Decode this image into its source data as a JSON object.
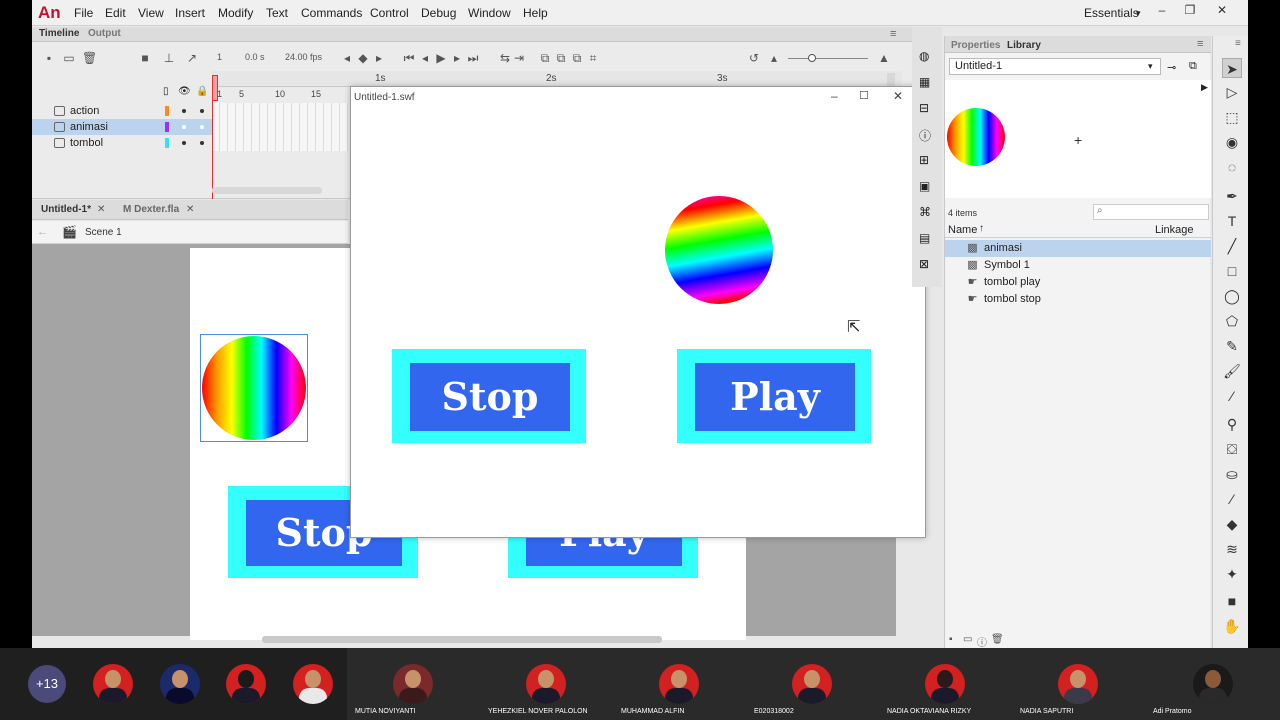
{
  "app": {
    "logo": "An",
    "menu": [
      "File",
      "Edit",
      "View",
      "Insert",
      "Modify",
      "Text",
      "Commands",
      "Control",
      "Debug",
      "Window",
      "Help"
    ],
    "workspace": "Essentials"
  },
  "timeline": {
    "tabs": [
      "Timeline",
      "Output"
    ],
    "frame": "1",
    "time": "0.0 s",
    "fps": "24.00 fps",
    "ruler_seconds": [
      "1s",
      "2s",
      "3s"
    ],
    "ruler_frames": [
      "1",
      "5",
      "10",
      "15"
    ],
    "layers": [
      {
        "name": "action",
        "color": "#ff8c1a"
      },
      {
        "name": "animasi",
        "color": "#9b30ff"
      },
      {
        "name": "tombol",
        "color": "#33e0ff"
      }
    ]
  },
  "document": {
    "tabs": [
      "Untitled-1*",
      "M Dexter.fla"
    ],
    "scene": "Scene 1"
  },
  "stage": {
    "stop_label": "Stop",
    "play_label": "Play"
  },
  "swf_window": {
    "title": "Untitled-1.swf",
    "stop_label": "Stop",
    "play_label": "Play"
  },
  "library": {
    "tabs": [
      "Properties",
      "Library"
    ],
    "document": "Untitled-1",
    "count": "4 items",
    "columns": [
      "Name",
      "Linkage"
    ],
    "items": [
      {
        "name": "animasi",
        "icon": "movieclip-icon"
      },
      {
        "name": "Symbol 1",
        "icon": "movieclip-icon"
      },
      {
        "name": "tombol play",
        "icon": "button-icon"
      },
      {
        "name": "tombol stop",
        "icon": "button-icon"
      }
    ]
  },
  "meeting": {
    "more": "+13",
    "participants": [
      "MUTIA NOVIYANTI",
      "YEHEZKIEL NOVER PALOLON",
      "MUHAMMAD ALFIN",
      "E020318002",
      "NADIA OKTAVIANA RIZKY",
      "NADIA SAPUTRI",
      "Adi Pratomo"
    ]
  }
}
